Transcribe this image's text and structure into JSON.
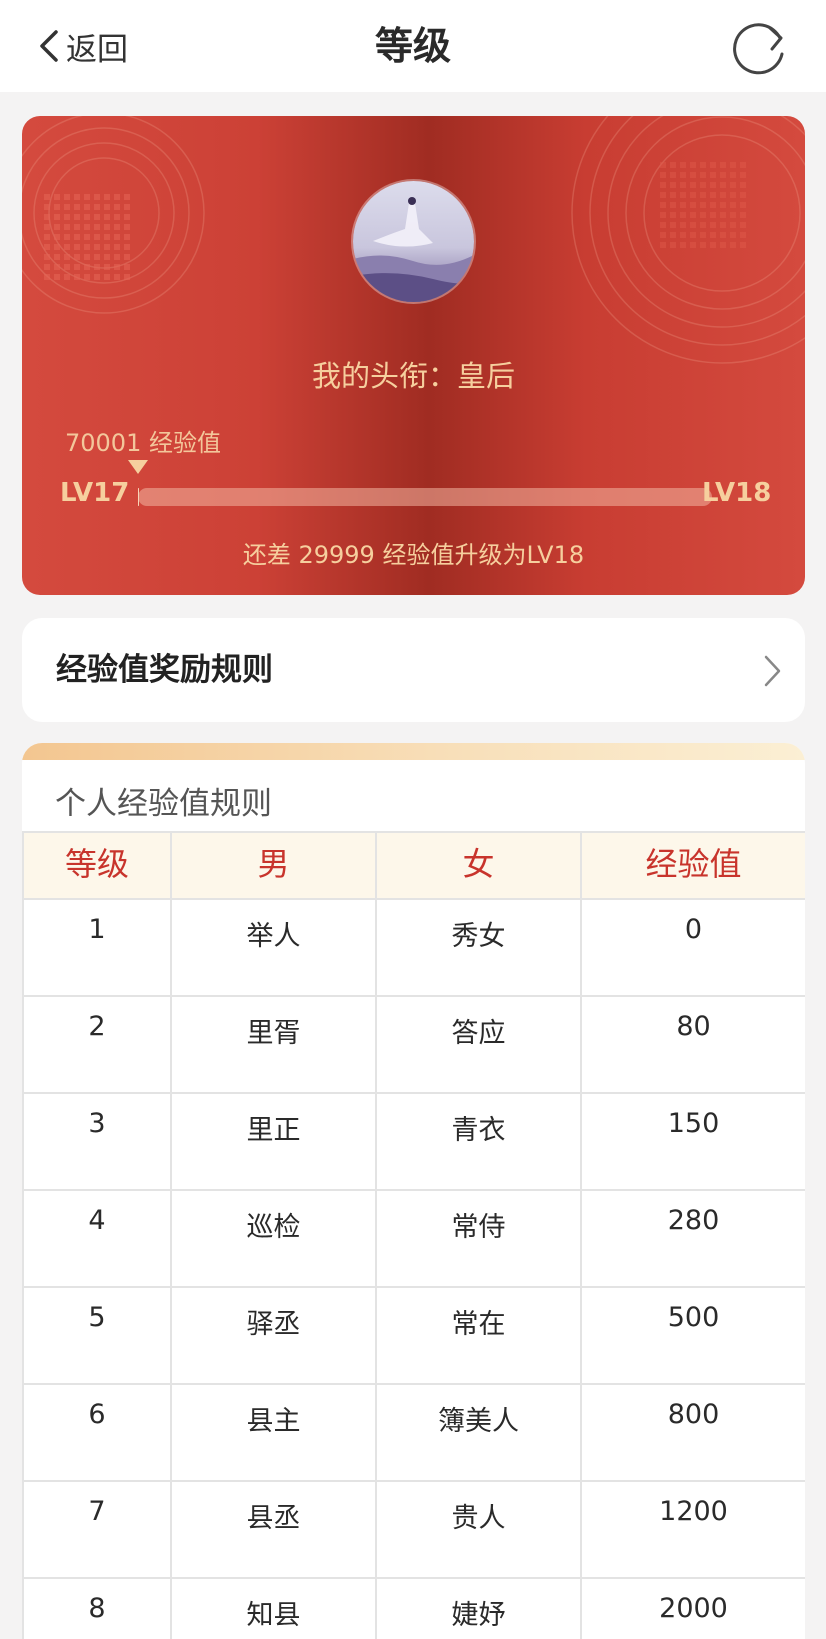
{
  "nav": {
    "back_label": "返回",
    "title": "等级"
  },
  "level_card": {
    "title_label": "我的头衔：",
    "title_value": "皇后",
    "current_exp": "70001 经验值",
    "current_level": "LV17",
    "next_level": "LV18",
    "progress_fraction": 0.001,
    "upgrade_hint": "还差 29999 经验值升级为LV18"
  },
  "rules_link": {
    "label": "经验值奖励规则"
  },
  "exp_table": {
    "heading": "个人经验值规则",
    "headers": [
      "等级",
      "男",
      "女",
      "经验值"
    ],
    "rows": [
      [
        "1",
        "举人",
        "秀女",
        "0"
      ],
      [
        "2",
        "里胥",
        "答应",
        "80"
      ],
      [
        "3",
        "里正",
        "青衣",
        "150"
      ],
      [
        "4",
        "巡检",
        "常侍",
        "280"
      ],
      [
        "5",
        "驿丞",
        "常在",
        "500"
      ],
      [
        "6",
        "县主",
        "簿美人",
        "800"
      ],
      [
        "7",
        "县丞",
        "贵人",
        "1200"
      ],
      [
        "8",
        "知县",
        "婕妤",
        "2000"
      ]
    ]
  },
  "colors": {
    "card_red": "#cc4136",
    "gold_text": "#f6cf9e",
    "table_header_text": "#c8342c"
  }
}
